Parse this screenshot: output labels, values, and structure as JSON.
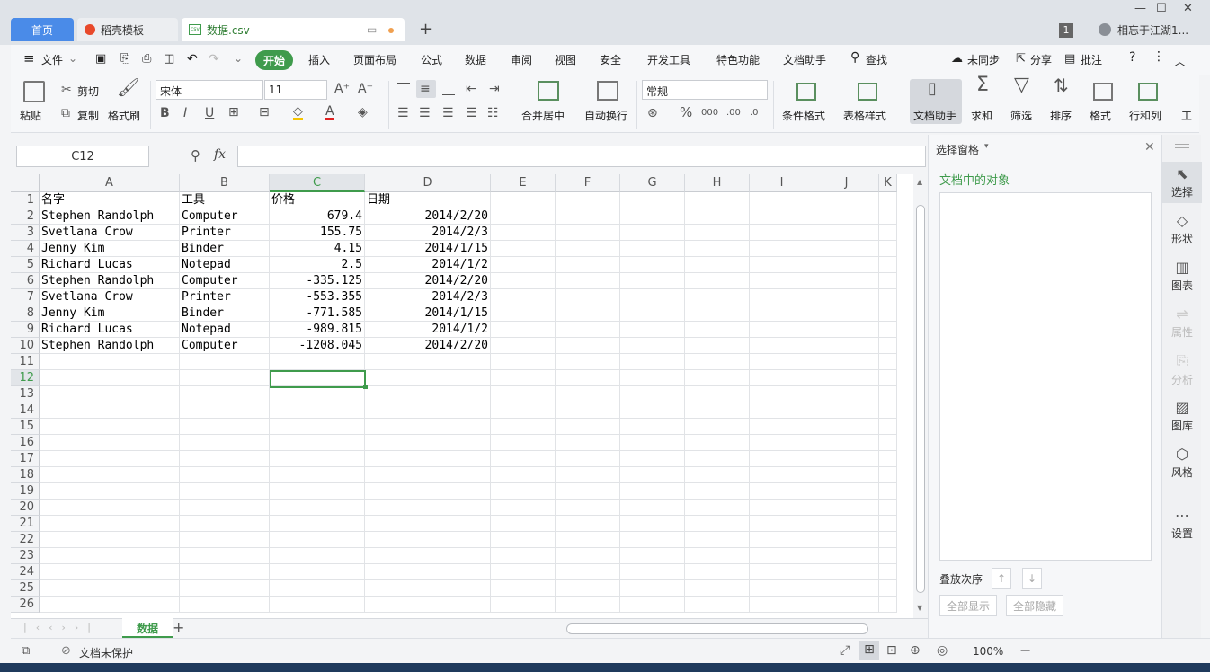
{
  "tabs": {
    "home": "首页",
    "template": "稻壳模板",
    "file": "数据.csv",
    "user": "相忘于江湖1...",
    "badge": "1"
  },
  "menu": {
    "file": "文件",
    "items": [
      "开始",
      "插入",
      "页面布局",
      "公式",
      "数据",
      "审阅",
      "视图",
      "安全",
      "开发工具",
      "特色功能",
      "文档助手"
    ],
    "search": "查找",
    "sync": "未同步",
    "share": "分享",
    "comment": "批注"
  },
  "ribbon": {
    "paste": "粘贴",
    "cut": "剪切",
    "copy": "复制",
    "format_painter": "格式刷",
    "font": "宋体",
    "font_size": "11",
    "merge": "合并居中",
    "wrap": "自动换行",
    "number_format": "常规",
    "cond_format": "条件格式",
    "table_style": "表格样式",
    "doc_helper": "文档助手",
    "sum": "求和",
    "filter": "筛选",
    "sort": "排序",
    "format": "格式",
    "rowcol": "行和列",
    "work": "工"
  },
  "formula": {
    "name_box": "C12",
    "fx": "fx",
    "value": ""
  },
  "columns": [
    "A",
    "B",
    "C",
    "D",
    "E",
    "F",
    "G",
    "H",
    "I",
    "J",
    "K"
  ],
  "rows": [
    [
      "名字",
      "工具",
      "价格",
      "日期"
    ],
    [
      "Stephen Randolph",
      "Computer",
      "679.4",
      "2014/2/20"
    ],
    [
      "Svetlana Crow",
      "Printer",
      "155.75",
      "2014/2/3"
    ],
    [
      "Jenny Kim",
      "Binder",
      "4.15",
      "2014/1/15"
    ],
    [
      "Richard Lucas",
      "Notepad",
      "2.5",
      "2014/1/2"
    ],
    [
      "Stephen Randolph",
      "Computer",
      "-335.125",
      "2014/2/20"
    ],
    [
      "Svetlana Crow",
      "Printer",
      "-553.355",
      "2014/2/3"
    ],
    [
      "Jenny Kim",
      "Binder",
      "-771.585",
      "2014/1/15"
    ],
    [
      "Richard Lucas",
      "Notepad",
      "-989.815",
      "2014/1/2"
    ],
    [
      "Stephen Randolph",
      "Computer",
      "-1208.045",
      "2014/2/20"
    ]
  ],
  "row_numbers": [
    "1",
    "2",
    "3",
    "4",
    "5",
    "6",
    "7",
    "8",
    "9",
    "10",
    "11",
    "12",
    "13",
    "14",
    "15",
    "16",
    "17",
    "18",
    "19",
    "20",
    "21",
    "22",
    "23",
    "24",
    "25",
    "26"
  ],
  "sheet_tab": "数据",
  "panel": {
    "title": "选择窗格",
    "objects_label": "文档中的对象",
    "order_label": "叠放次序",
    "show_all": "全部显示",
    "hide_all": "全部隐藏"
  },
  "sidebar": [
    "选择",
    "形状",
    "图表",
    "属性",
    "分析",
    "图库",
    "风格",
    "设置"
  ],
  "status": {
    "protect": "文档未保护",
    "zoom": "100%"
  },
  "accent": "#3f9b4c"
}
